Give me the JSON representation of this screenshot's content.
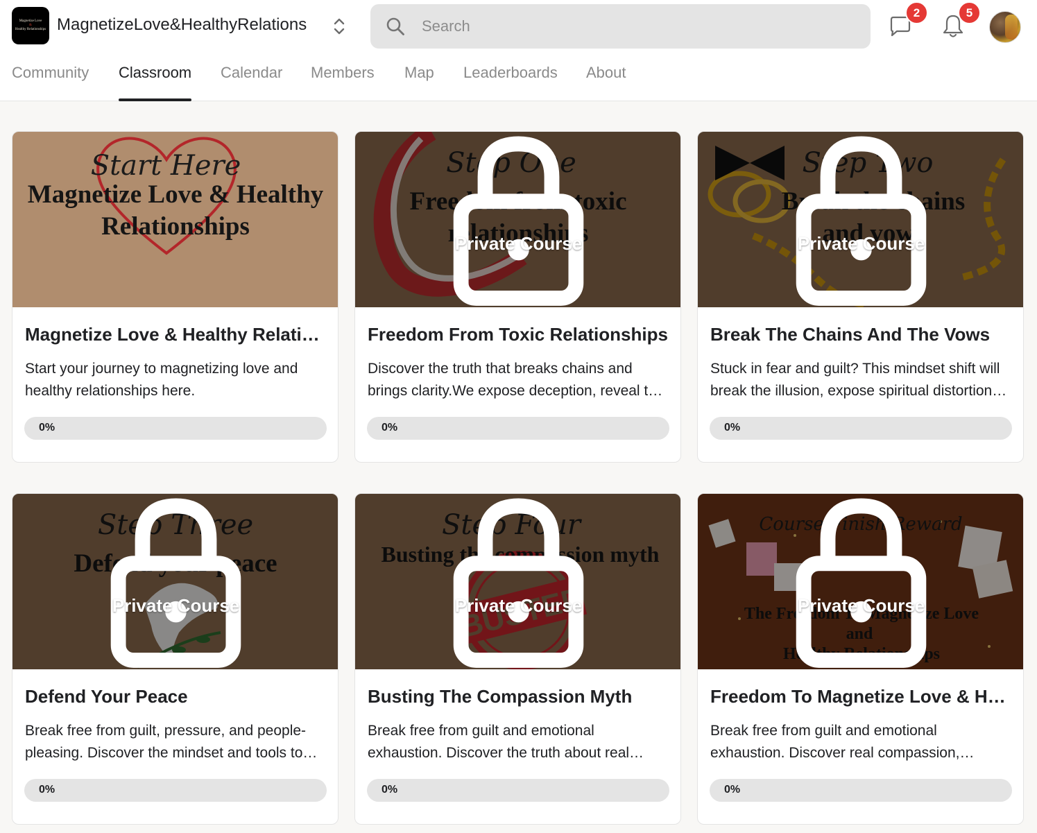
{
  "app": {
    "group_name": "MagnetizeLove&HealthyRelations",
    "logo_text": [
      "Magnetize Love",
      "&",
      "Healthy Relationships"
    ]
  },
  "search": {
    "placeholder": "Search",
    "value": ""
  },
  "notifications": {
    "chat_count": "2",
    "bell_count": "5"
  },
  "tabs": [
    {
      "label": "Community",
      "active": false
    },
    {
      "label": "Classroom",
      "active": true
    },
    {
      "label": "Calendar",
      "active": false
    },
    {
      "label": "Members",
      "active": false
    },
    {
      "label": "Map",
      "active": false
    },
    {
      "label": "Leaderboards",
      "active": false
    },
    {
      "label": "About",
      "active": false
    }
  ],
  "colors": {
    "accent": "#202124",
    "badge": "#e53935",
    "card_brown": "#6b4f37",
    "start_tan": "#b08d6e",
    "reward_brown": "#5a2a12"
  },
  "courses": [
    {
      "title": "Magnetize Love & Healthy Relationships",
      "description": "Start your journey to magnetizing love and healthy relationships here.",
      "progress_label": "0%",
      "progress": 0,
      "locked": false,
      "thumb": {
        "script": "Start Here",
        "lines": [
          "Magnetize Love & Healthy",
          "Relationships"
        ]
      }
    },
    {
      "title": "Freedom From Toxic Relationships",
      "description": "Discover the truth that breaks chains and brings clarity.We expose deception, reveal the real meaning of marriage and freedom in Christ.",
      "progress_label": "0%",
      "progress": 0,
      "locked": true,
      "private_label": "Private Course",
      "thumb": {
        "script": "Step One",
        "lines": [
          "Freedom from toxic",
          "relationships"
        ]
      }
    },
    {
      "title": "Break The Chains And The Vows",
      "description": "Stuck in fear and guilt? This mindset shift will break the illusion, expose spiritual distortion and set you free.",
      "progress_label": "0%",
      "progress": 0,
      "locked": true,
      "private_label": "Private Course",
      "thumb": {
        "script": "Step Two",
        "lines": [
          "Break the chains",
          "and vows"
        ]
      }
    },
    {
      "title": "Defend Your Peace",
      "description": "Break free from guilt, pressure, and people-pleasing. Discover the mindset and tools to protect your peace.",
      "progress_label": "0%",
      "progress": 0,
      "locked": true,
      "private_label": "Private Course",
      "thumb": {
        "script": "Step Three",
        "lines": [
          "Defend your peace"
        ]
      }
    },
    {
      "title": "Busting The Compassion Myth",
      "description": "Break free from guilt and emotional exhaustion. Discover the truth about real compassion.",
      "progress_label": "0%",
      "progress": 0,
      "locked": true,
      "private_label": "Private Course",
      "thumb": {
        "script": "Step Four",
        "lines": [
          "Busting the compassion myth"
        ],
        "stamp": "BUSTED"
      }
    },
    {
      "title": "Freedom To Magnetize Love & Healthy Relationships",
      "description": "Break free from guilt and emotional exhaustion. Discover real compassion, freedom and love.",
      "progress_label": "0%",
      "progress": 0,
      "locked": true,
      "private_label": "Private Course",
      "thumb": {
        "script": "Course Finish Reward",
        "lines": [
          "The Freedom To Magnetize Love",
          "and",
          "Healthy Relationships"
        ]
      }
    }
  ]
}
